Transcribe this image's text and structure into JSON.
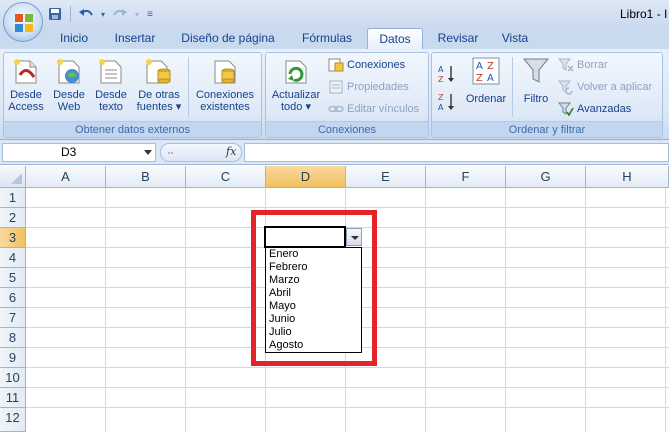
{
  "window": {
    "title": "Libro1 - I"
  },
  "quick_access": {
    "save_icon": "save-icon",
    "undo_icon": "undo-icon",
    "redo_icon": "redo-icon",
    "customize_icon": "customize-icon"
  },
  "tabs": [
    "Inicio",
    "Insertar",
    "Diseño de página",
    "Fórmulas",
    "Datos",
    "Revisar",
    "Vista"
  ],
  "active_tab": "Datos",
  "ribbon": {
    "groups": {
      "external": {
        "label": "Obtener datos externos",
        "buttons": [
          {
            "line1": "Desde",
            "line2": "Access"
          },
          {
            "line1": "Desde",
            "line2": "Web"
          },
          {
            "line1": "Desde",
            "line2": "texto"
          },
          {
            "line1": "De otras",
            "line2": "fuentes ▾"
          },
          {
            "line1": "Conexiones",
            "line2": "existentes"
          }
        ]
      },
      "connections": {
        "label": "Conexiones",
        "refresh": {
          "line1": "Actualizar",
          "line2": "todo ▾"
        },
        "items": [
          "Conexiones",
          "Propiedades",
          "Editar vínculos"
        ]
      },
      "sort_filter": {
        "label": "Ordenar y filtrar",
        "sort": "Ordenar",
        "filter": "Filtro",
        "items": [
          "Borrar",
          "Volver a aplicar",
          "Avanzadas"
        ]
      }
    }
  },
  "formula_bar": {
    "name_box": "D3",
    "fx": "fx",
    "formula": ""
  },
  "sheet": {
    "columns": [
      "A",
      "B",
      "C",
      "D",
      "E",
      "F",
      "G",
      "H"
    ],
    "rows": [
      "1",
      "2",
      "3",
      "4",
      "5",
      "6",
      "7",
      "8",
      "9",
      "10",
      "11",
      "12"
    ],
    "selected_column": "D",
    "selected_row": "3",
    "active_cell_value": ""
  },
  "dropdown": {
    "options": [
      "Enero",
      "Febrero",
      "Marzo",
      "Abril",
      "Mayo",
      "Junio",
      "Julio",
      "Agosto"
    ]
  },
  "highlight_color": "#e3242b"
}
